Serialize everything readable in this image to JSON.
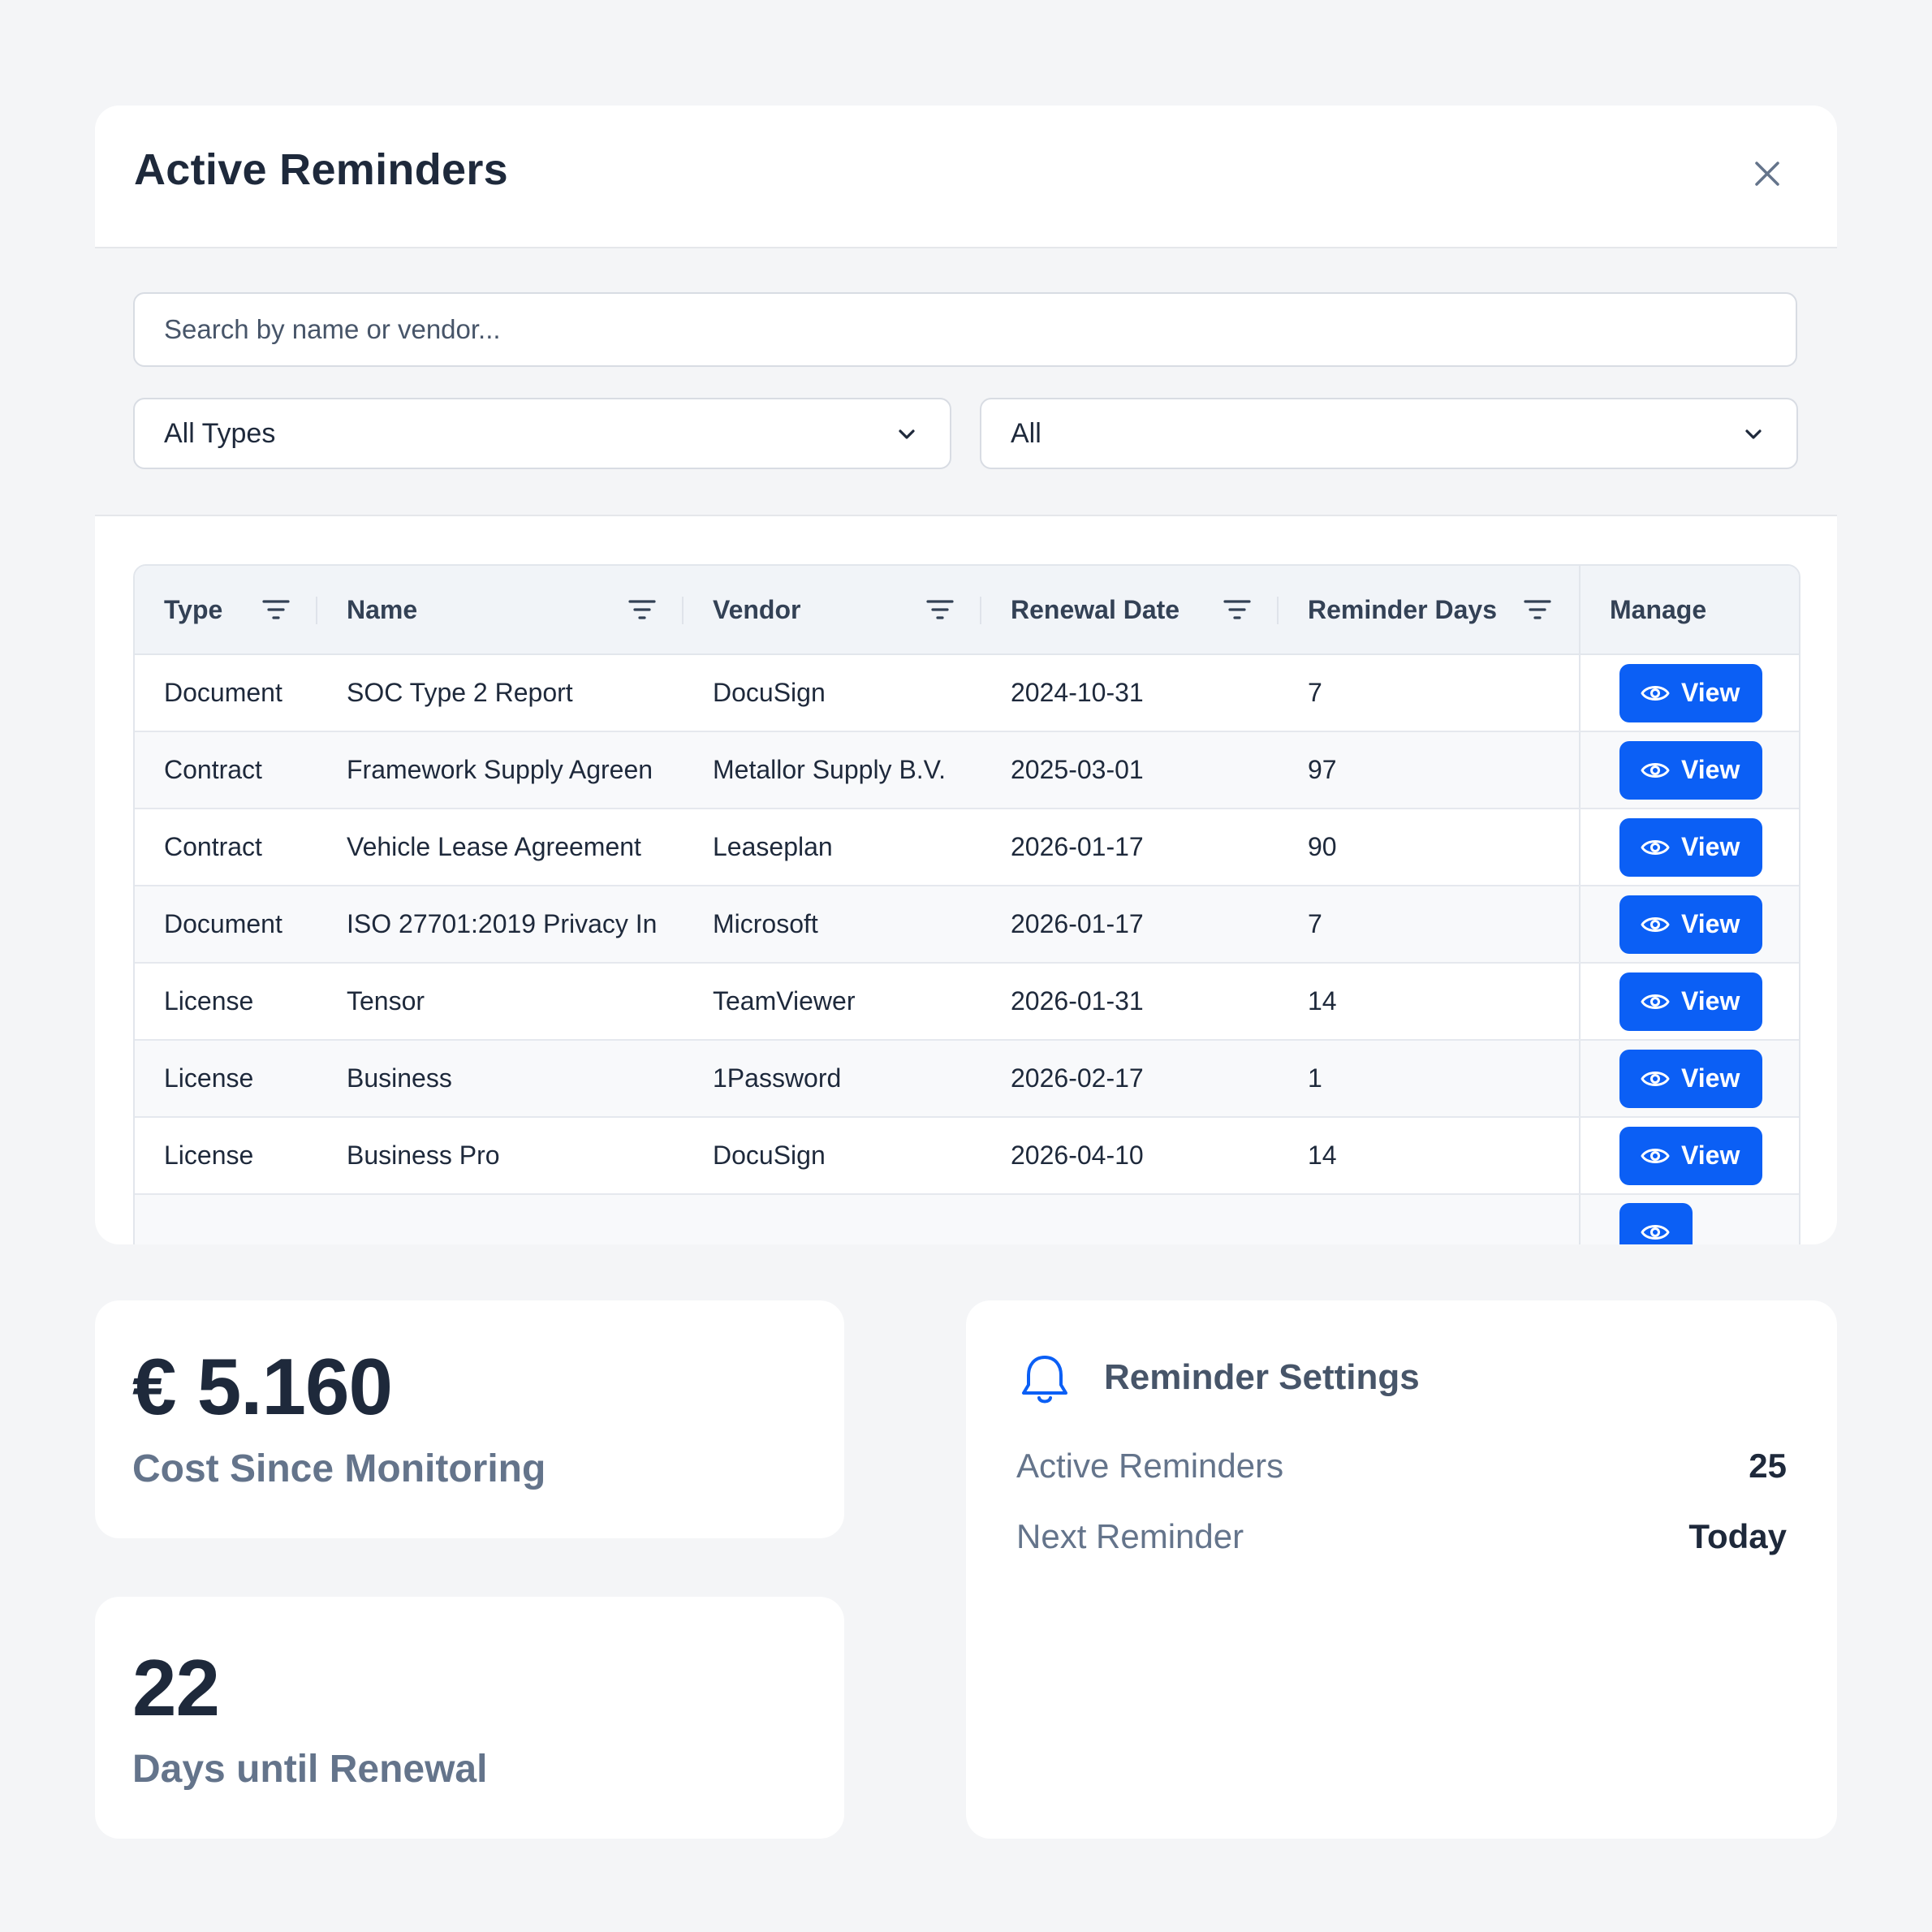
{
  "modal": {
    "title": "Active Reminders",
    "search_placeholder": "Search by name or vendor...",
    "type_filter": "All Types",
    "status_filter": "All"
  },
  "table": {
    "columns": [
      "Type",
      "Name",
      "Vendor",
      "Renewal Date",
      "Reminder Days",
      "Manage"
    ],
    "view_label": "View",
    "rows": [
      {
        "type": "Document",
        "name": "SOC Type 2 Report",
        "vendor": "DocuSign",
        "renewal_date": "2024-10-31",
        "reminder_days": "7"
      },
      {
        "type": "Contract",
        "name": "Framework Supply Agreen",
        "vendor": "Metallor Supply B.V.",
        "renewal_date": "2025-03-01",
        "reminder_days": "97"
      },
      {
        "type": "Contract",
        "name": "Vehicle Lease Agreement",
        "vendor": "Leaseplan",
        "renewal_date": "2026-01-17",
        "reminder_days": "90"
      },
      {
        "type": "Document",
        "name": "ISO 27701:2019 Privacy In",
        "vendor": "Microsoft",
        "renewal_date": "2026-01-17",
        "reminder_days": "7"
      },
      {
        "type": "License",
        "name": "Tensor",
        "vendor": "TeamViewer",
        "renewal_date": "2026-01-31",
        "reminder_days": "14"
      },
      {
        "type": "License",
        "name": "Business",
        "vendor": "1Password",
        "renewal_date": "2026-02-17",
        "reminder_days": "1"
      },
      {
        "type": "License",
        "name": "Business Pro",
        "vendor": "DocuSign",
        "renewal_date": "2026-04-10",
        "reminder_days": "14"
      }
    ]
  },
  "cost_card": {
    "value": "€ 5.160",
    "label": "Cost Since Monitoring"
  },
  "days_card": {
    "value": "22",
    "label": "Days until Renewal"
  },
  "settings": {
    "title": "Reminder Settings",
    "active_label": "Active Reminders",
    "active_value": "25",
    "next_label": "Next Reminder",
    "next_value": "Today"
  },
  "colors": {
    "accent": "#0b5ff5",
    "background": "#f4f5f7",
    "text": "#1e293b",
    "muted": "#64748b"
  },
  "icons": {
    "close": "close-icon",
    "filter": "filter-icon",
    "chevron": "chevron-down-icon",
    "eye": "eye-icon",
    "bell": "bell-icon"
  }
}
